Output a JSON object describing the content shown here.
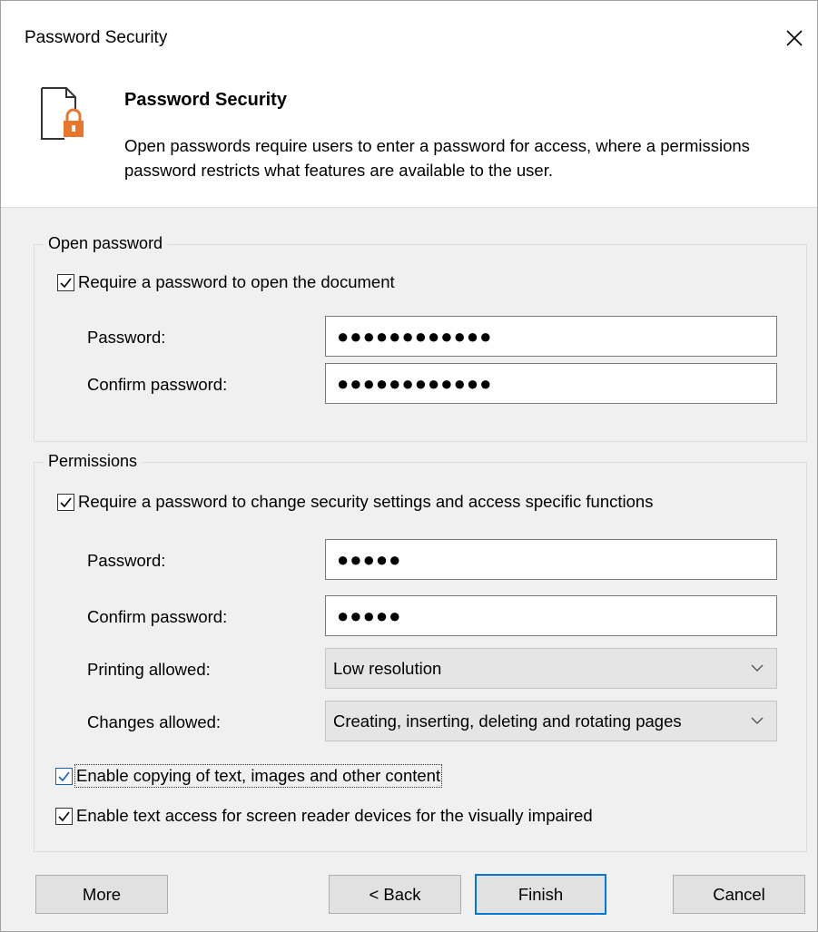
{
  "window": {
    "title": "Password Security"
  },
  "header": {
    "title": "Password Security",
    "description": "Open passwords require users to enter a password for access, where a permissions password restricts what features are available to the user."
  },
  "open_password": {
    "group_label": "Open password",
    "require_label": "Require a password to open the document",
    "require_checked": true,
    "password_label": "Password:",
    "password_value": "●●●●●●●●●●●●",
    "confirm_label": "Confirm password:",
    "confirm_value": "●●●●●●●●●●●●"
  },
  "permissions": {
    "group_label": "Permissions",
    "require_label": "Require a password to change security settings and access specific functions",
    "require_checked": true,
    "password_label": "Password:",
    "password_value": "●●●●●",
    "confirm_label": "Confirm password:",
    "confirm_value": "●●●●●",
    "printing_label": "Printing allowed:",
    "printing_value": "Low resolution",
    "changes_label": "Changes allowed:",
    "changes_value": "Creating, inserting, deleting and rotating pages",
    "copy_label": "Enable copying of text, images and other content",
    "copy_checked": true,
    "screenreader_label": "Enable text access for screen reader devices for the visually impaired",
    "screenreader_checked": true
  },
  "buttons": {
    "more": "More",
    "back": "< Back",
    "finish": "Finish",
    "cancel": "Cancel"
  },
  "icons": {
    "close": "close-icon",
    "document_lock": "document-lock-icon",
    "chevron": "chevron-down-icon",
    "check": "checkmark-icon"
  },
  "colors": {
    "accent": "#0078d7",
    "lock": "#e8762d"
  }
}
